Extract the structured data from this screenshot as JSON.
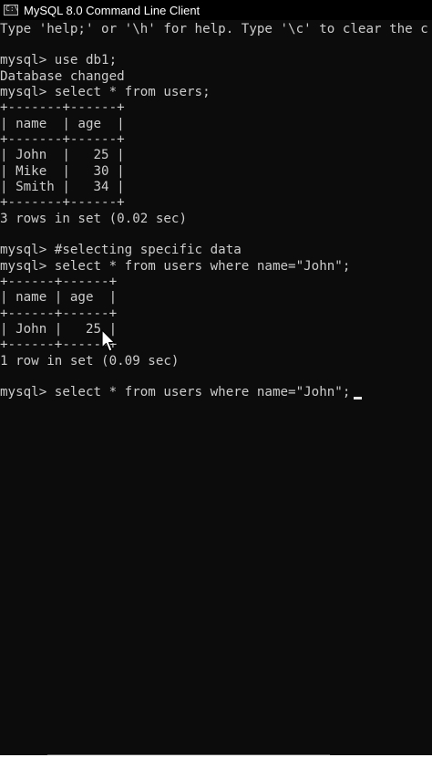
{
  "window": {
    "title": "MySQL 8.0 Command Line Client",
    "icon": "console-icon",
    "icon_glyph": "C:\\"
  },
  "colors": {
    "background": "#0c0c0c",
    "text": "#cccccc",
    "titlebar": "#000000"
  },
  "console": {
    "lines": [
      "Type 'help;' or '\\h' for help. Type '\\c' to clear the c",
      "",
      "mysql> use db1;",
      "Database changed",
      "mysql> select * from users;",
      "+-------+------+",
      "| name  | age  |",
      "+-------+------+",
      "| John  |   25 |",
      "| Mike  |   30 |",
      "| Smith |   34 |",
      "+-------+------+",
      "3 rows in set (0.02 sec)",
      "",
      "mysql> #selecting specific data",
      "mysql> select * from users where name=\"John\";",
      "+------+------+",
      "| name | age  |",
      "+------+------+",
      "| John |   25 |",
      "+------+------+",
      "1 row in set (0.09 sec)",
      "",
      "mysql> select * from users where name=\"John\";"
    ]
  }
}
